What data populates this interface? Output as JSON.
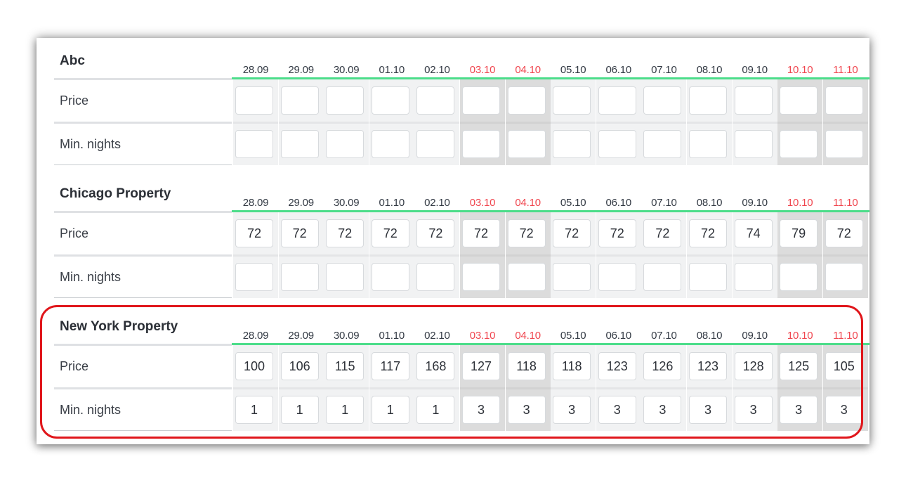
{
  "dates": [
    {
      "label": "28.09",
      "weekend": false
    },
    {
      "label": "29.09",
      "weekend": false
    },
    {
      "label": "30.09",
      "weekend": false
    },
    {
      "label": "01.10",
      "weekend": false
    },
    {
      "label": "02.10",
      "weekend": false
    },
    {
      "label": "03.10",
      "weekend": true
    },
    {
      "label": "04.10",
      "weekend": true
    },
    {
      "label": "05.10",
      "weekend": false
    },
    {
      "label": "06.10",
      "weekend": false
    },
    {
      "label": "07.10",
      "weekend": false
    },
    {
      "label": "08.10",
      "weekend": false
    },
    {
      "label": "09.10",
      "weekend": false
    },
    {
      "label": "10.10",
      "weekend": true
    },
    {
      "label": "11.10",
      "weekend": true
    }
  ],
  "properties": [
    {
      "name": "Abc",
      "rows": [
        {
          "label": "Price",
          "values": [
            "",
            "",
            "",
            "",
            "",
            "",
            "",
            "",
            "",
            "",
            "",
            "",
            "",
            ""
          ]
        },
        {
          "label": "Min. nights",
          "values": [
            "",
            "",
            "",
            "",
            "",
            "",
            "",
            "",
            "",
            "",
            "",
            "",
            "",
            ""
          ]
        }
      ]
    },
    {
      "name": "Chicago Property",
      "rows": [
        {
          "label": "Price",
          "values": [
            "72",
            "72",
            "72",
            "72",
            "72",
            "72",
            "72",
            "72",
            "72",
            "72",
            "72",
            "74",
            "79",
            "72"
          ]
        },
        {
          "label": "Min. nights",
          "values": [
            "",
            "",
            "",
            "",
            "",
            "",
            "",
            "",
            "",
            "",
            "",
            "",
            "",
            ""
          ]
        }
      ]
    },
    {
      "name": "New York Property",
      "highlighted": true,
      "rows": [
        {
          "label": "Price",
          "values": [
            "100",
            "106",
            "115",
            "117",
            "168",
            "127",
            "118",
            "118",
            "123",
            "126",
            "123",
            "128",
            "125",
            "105"
          ]
        },
        {
          "label": "Min. nights",
          "values": [
            "1",
            "1",
            "1",
            "1",
            "1",
            "3",
            "3",
            "3",
            "3",
            "3",
            "3",
            "3",
            "3",
            "3"
          ]
        }
      ]
    }
  ],
  "colors": {
    "weekend_date": "#f0454e",
    "header_underline": "#4cdd8a",
    "highlight_border": "#e0161b"
  }
}
